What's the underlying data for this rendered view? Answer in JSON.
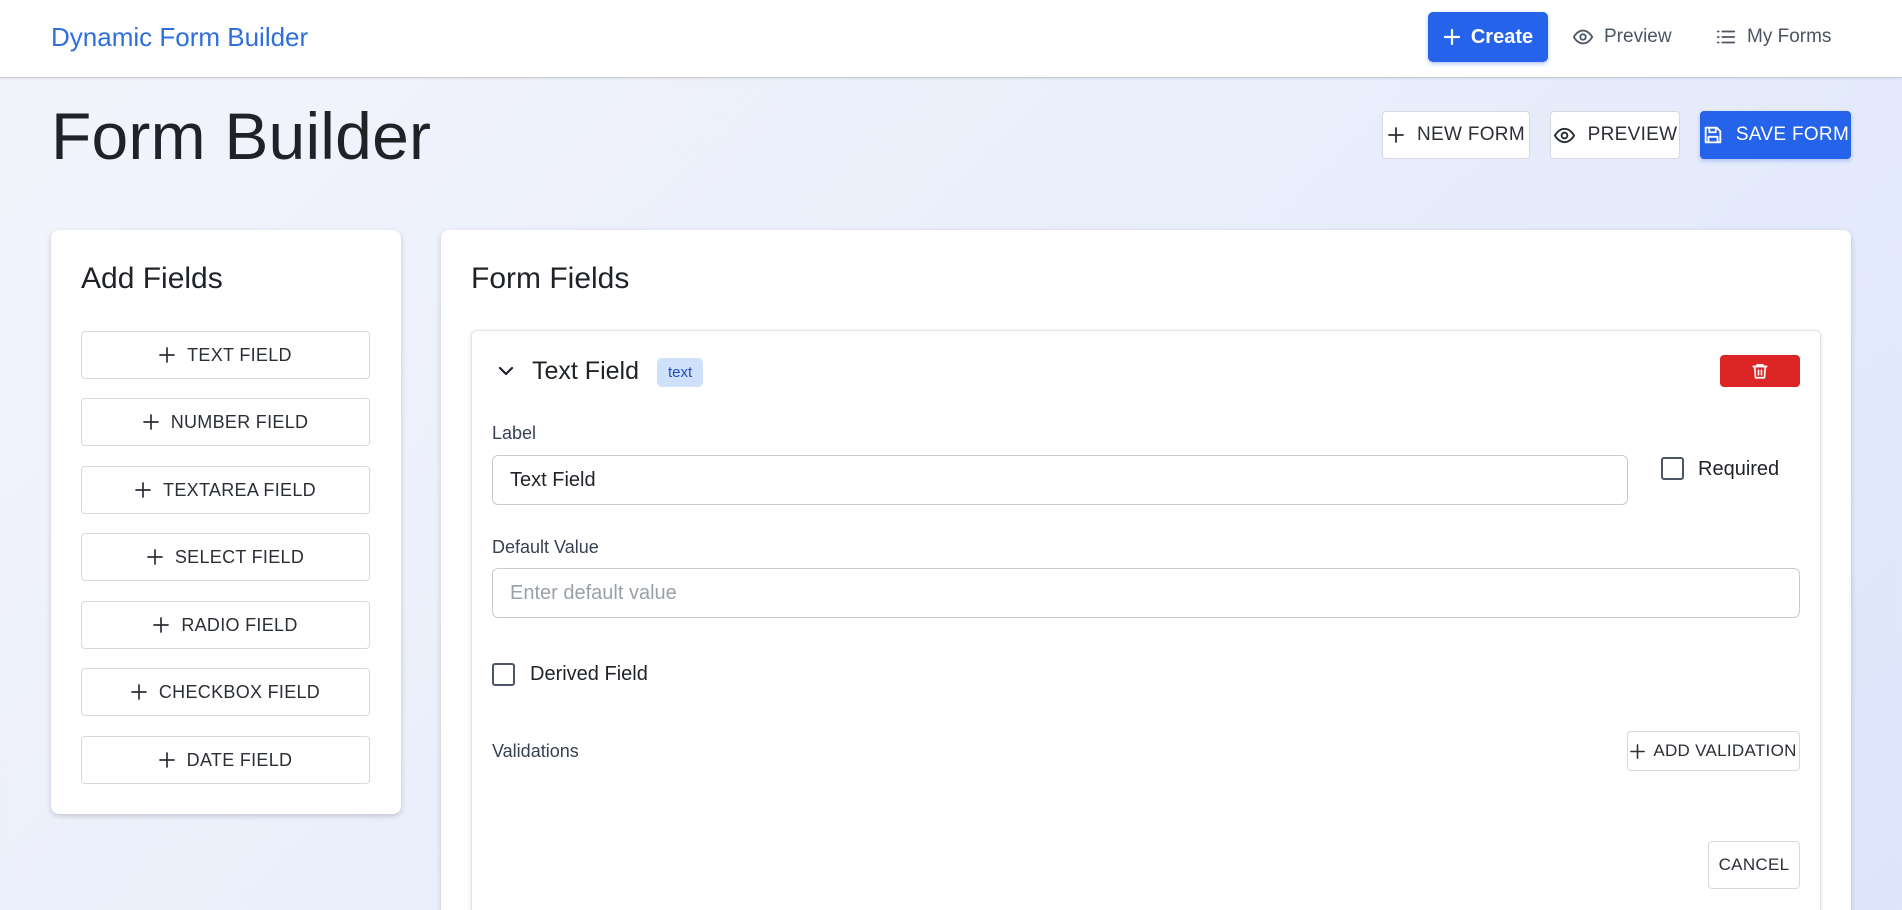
{
  "app": {
    "brand": "Dynamic Form Builder",
    "nav": {
      "create": "Create",
      "preview": "Preview",
      "my_forms": "My Forms"
    }
  },
  "header": {
    "title": "Form Builder",
    "new_form": "NEW FORM",
    "preview": "PREVIEW",
    "save_form": "SAVE FORM"
  },
  "add_fields": {
    "title": "Add Fields",
    "buttons": [
      "TEXT FIELD",
      "NUMBER FIELD",
      "TEXTAREA FIELD",
      "SELECT FIELD",
      "RADIO FIELD",
      "CHECKBOX FIELD",
      "DATE FIELD"
    ]
  },
  "form_fields": {
    "title": "Form Fields",
    "field": {
      "title": "Text Field",
      "type_chip": "text",
      "label_caption": "Label",
      "label_value": "Text Field",
      "required_label": "Required",
      "required_checked": false,
      "default_caption": "Default Value",
      "default_placeholder": "Enter default value",
      "derived_label": "Derived Field",
      "derived_checked": false,
      "validations_caption": "Validations",
      "add_validation": "ADD VALIDATION",
      "cancel": "CANCEL"
    }
  },
  "colors": {
    "primary": "#2563eb",
    "brand_text": "#2f6fdc",
    "danger": "#dc2626",
    "chip_bg": "#cfe0fb"
  },
  "icons": {
    "create": "plus-icon",
    "preview": "eye-icon",
    "my_forms": "list-icon",
    "save": "floppy-disk-icon",
    "delete": "trash-icon",
    "expand": "chevron-down-icon"
  }
}
